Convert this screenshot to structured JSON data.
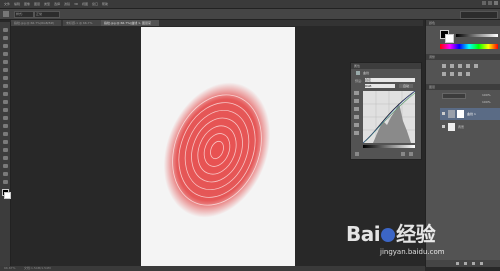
{
  "menubar": {
    "items": [
      "文件",
      "编辑",
      "图像",
      "图层",
      "类型",
      "选择",
      "滤镜",
      "3D",
      "视图",
      "窗口",
      "帮助"
    ]
  },
  "options": {
    "preset_label": "样式:",
    "preset_value": "正常"
  },
  "tabs": [
    {
      "label": "指纹.jpg @ 66.7%(RGB/8#)",
      "active": false
    },
    {
      "label": "未标题-1 @ 66.7%",
      "active": false
    },
    {
      "label": "指纹.jpg @ 66.7%(曲线 1, 图层蒙版/8)",
      "active": true
    }
  ],
  "curves": {
    "title": "属性",
    "subtitle": "曲线",
    "preset_label": "预设:",
    "preset_value": "自定",
    "channel_value": "RGB",
    "auto_label": "自动"
  },
  "panels": {
    "color_title": "颜色",
    "adjust_title": "调整",
    "layers_title": "图层",
    "layer_names": [
      "曲线 1",
      "背景"
    ],
    "opacity_value": "100%",
    "fill_value": "100%"
  },
  "statusbar": {
    "zoom": "66.67%",
    "doc_info": "文档:1.54M/1.54M"
  },
  "watermark": {
    "brand": "Bai",
    "brand_cn": "经验",
    "url": "jingyan.baidu.com"
  },
  "colors": {
    "ui_dark": "#282828",
    "panel": "#535353",
    "fingerprint": "#e23c3c"
  }
}
